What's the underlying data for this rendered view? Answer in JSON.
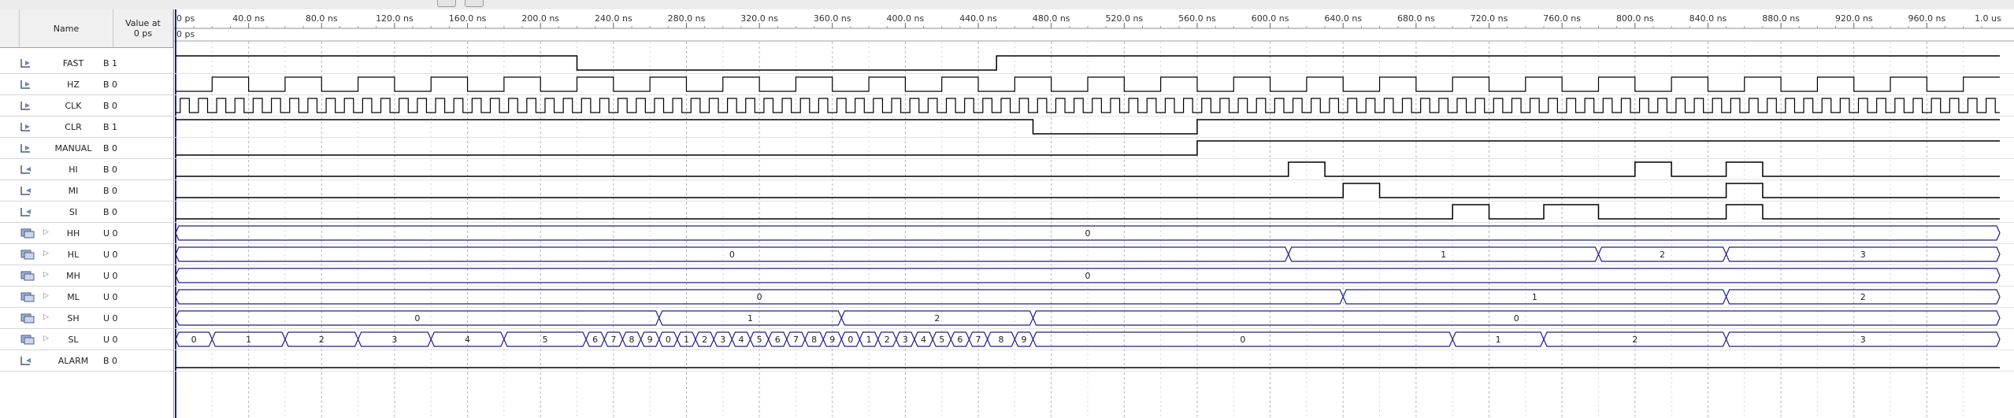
{
  "columns": {
    "name": "Name",
    "value_line1": "Value at",
    "value_line2": "0 ps"
  },
  "time_axis": {
    "start_label": "0 ps",
    "cursor_label": "0 ps",
    "end_label": "1.0 us",
    "tick_labels": [
      "40.0 ns",
      "80.0 ns",
      "120.0 ns",
      "160.0 ns",
      "200.0 ns",
      "240.0 ns",
      "280.0 ns",
      "320.0 ns",
      "360.0 ns",
      "400.0 ns",
      "440.0 ns",
      "480.0 ns",
      "520.0 ns",
      "560.0 ns",
      "600.0 ns",
      "640.0 ns",
      "680.0 ns",
      "720.0 ns",
      "760.0 ns",
      "800.0 ns",
      "840.0 ns",
      "880.0 ns",
      "920.0 ns",
      "960.0 ns"
    ],
    "tick_times_ns": [
      40,
      80,
      120,
      160,
      200,
      240,
      280,
      320,
      360,
      400,
      440,
      480,
      520,
      560,
      600,
      640,
      680,
      720,
      760,
      800,
      840,
      880,
      920,
      960
    ],
    "range_ns": [
      0,
      1000
    ]
  },
  "colors": {
    "wave": "#000000",
    "bus": "#1e1e8c",
    "grid": "#b4b4b4",
    "cursor": "#1e1e8c"
  },
  "signals": [
    {
      "name": "FAST",
      "value": "B 1",
      "kind": "input",
      "type": "bit",
      "init": 1,
      "edges_ns": [
        220,
        450
      ]
    },
    {
      "name": "HZ",
      "value": "B 0",
      "kind": "input",
      "type": "clock",
      "init": 0,
      "first_edge_ns": 20,
      "half_period_ns": 20
    },
    {
      "name": "CLK",
      "value": "B 0",
      "kind": "input",
      "type": "clock",
      "init": 0,
      "first_edge_ns": 2.5,
      "half_period_ns": 5
    },
    {
      "name": "CLR",
      "value": "B 1",
      "kind": "input",
      "type": "bit",
      "init": 1,
      "edges_ns": [
        470,
        560
      ]
    },
    {
      "name": "MANUAL",
      "value": "B 0",
      "kind": "input",
      "type": "bit",
      "init": 0,
      "edges_ns": [
        560
      ]
    },
    {
      "name": "HI",
      "value": "B 0",
      "kind": "output",
      "type": "bit",
      "init": 0,
      "edges_ns": [
        610,
        630,
        800,
        820,
        850,
        870
      ]
    },
    {
      "name": "MI",
      "value": "B 0",
      "kind": "output",
      "type": "bit",
      "init": 0,
      "edges_ns": [
        640,
        660,
        850,
        870
      ]
    },
    {
      "name": "SI",
      "value": "B 0",
      "kind": "output",
      "type": "bit",
      "init": 0,
      "edges_ns": [
        700,
        720,
        750,
        780,
        850,
        870
      ]
    },
    {
      "name": "HH",
      "value": "U 0",
      "kind": "bus",
      "type": "bus",
      "segments": [
        {
          "start": 0,
          "end": 1000,
          "label": "0"
        }
      ]
    },
    {
      "name": "HL",
      "value": "U 0",
      "kind": "bus",
      "type": "bus",
      "segments": [
        {
          "start": 0,
          "end": 610,
          "label": "0"
        },
        {
          "start": 610,
          "end": 780,
          "label": "1"
        },
        {
          "start": 780,
          "end": 850,
          "label": "2"
        },
        {
          "start": 850,
          "end": 1000,
          "label": "3"
        }
      ]
    },
    {
      "name": "MH",
      "value": "U 0",
      "kind": "bus",
      "type": "bus",
      "segments": [
        {
          "start": 0,
          "end": 1000,
          "label": "0"
        }
      ]
    },
    {
      "name": "ML",
      "value": "U 0",
      "kind": "bus",
      "type": "bus",
      "segments": [
        {
          "start": 0,
          "end": 640,
          "label": "0"
        },
        {
          "start": 640,
          "end": 850,
          "label": "1"
        },
        {
          "start": 850,
          "end": 1000,
          "label": "2"
        }
      ]
    },
    {
      "name": "SH",
      "value": "U 0",
      "kind": "bus",
      "type": "bus",
      "segments": [
        {
          "start": 0,
          "end": 265,
          "label": "0"
        },
        {
          "start": 265,
          "end": 365,
          "label": "1"
        },
        {
          "start": 365,
          "end": 470,
          "label": "2"
        },
        {
          "start": 470,
          "end": 1000,
          "label": "0"
        }
      ]
    },
    {
      "name": "SL",
      "value": "U 0",
      "kind": "bus",
      "type": "bus",
      "segments": [
        {
          "start": 0,
          "end": 20,
          "label": "0"
        },
        {
          "start": 20,
          "end": 60,
          "label": "1"
        },
        {
          "start": 60,
          "end": 100,
          "label": "2"
        },
        {
          "start": 100,
          "end": 140,
          "label": "3"
        },
        {
          "start": 140,
          "end": 180,
          "label": "4"
        },
        {
          "start": 180,
          "end": 225,
          "label": "5"
        },
        {
          "start": 225,
          "end": 235,
          "label": "6"
        },
        {
          "start": 235,
          "end": 245,
          "label": "7"
        },
        {
          "start": 245,
          "end": 255,
          "label": "8"
        },
        {
          "start": 255,
          "end": 265,
          "label": "9"
        },
        {
          "start": 265,
          "end": 275,
          "label": "0"
        },
        {
          "start": 275,
          "end": 285,
          "label": "1"
        },
        {
          "start": 285,
          "end": 295,
          "label": "2"
        },
        {
          "start": 295,
          "end": 305,
          "label": "3"
        },
        {
          "start": 305,
          "end": 315,
          "label": "4"
        },
        {
          "start": 315,
          "end": 325,
          "label": "5"
        },
        {
          "start": 325,
          "end": 335,
          "label": "6"
        },
        {
          "start": 335,
          "end": 345,
          "label": "7"
        },
        {
          "start": 345,
          "end": 355,
          "label": "8"
        },
        {
          "start": 355,
          "end": 365,
          "label": "9"
        },
        {
          "start": 365,
          "end": 375,
          "label": "0"
        },
        {
          "start": 375,
          "end": 385,
          "label": "1"
        },
        {
          "start": 385,
          "end": 395,
          "label": "2"
        },
        {
          "start": 395,
          "end": 405,
          "label": "3"
        },
        {
          "start": 405,
          "end": 415,
          "label": "4"
        },
        {
          "start": 415,
          "end": 425,
          "label": "5"
        },
        {
          "start": 425,
          "end": 435,
          "label": "6"
        },
        {
          "start": 435,
          "end": 445,
          "label": "7"
        },
        {
          "start": 445,
          "end": 460,
          "label": "8"
        },
        {
          "start": 460,
          "end": 470,
          "label": "9"
        },
        {
          "start": 470,
          "end": 700,
          "label": "0"
        },
        {
          "start": 700,
          "end": 750,
          "label": "1"
        },
        {
          "start": 750,
          "end": 850,
          "label": "2"
        },
        {
          "start": 850,
          "end": 1000,
          "label": "3"
        }
      ]
    },
    {
      "name": "ALARM",
      "value": "B 0",
      "kind": "output",
      "type": "bit",
      "init": 0,
      "edges_ns": []
    }
  ]
}
